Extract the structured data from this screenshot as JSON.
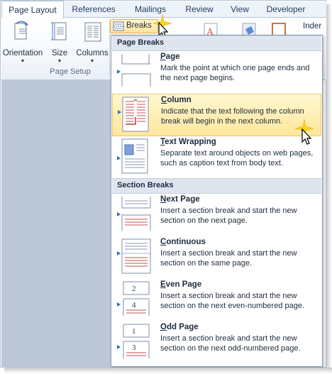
{
  "ribbon": {
    "tabs": [
      {
        "label": "Page Layout",
        "active": true
      },
      {
        "label": "References",
        "active": false
      },
      {
        "label": "Mailings",
        "active": false
      },
      {
        "label": "Review",
        "active": false
      },
      {
        "label": "View",
        "active": false
      },
      {
        "label": "Developer",
        "active": false
      }
    ],
    "buttons": {
      "orientation": "Orientation",
      "size": "Size",
      "columns": "Columns",
      "breaks": "Breaks",
      "indent": "Inder"
    },
    "group_label": "Page Setup"
  },
  "menu": {
    "page_breaks_header": "Page Breaks",
    "section_breaks_header": "Section Breaks",
    "items": [
      {
        "key": "P",
        "rest": "age",
        "desc": "Mark the point at which one page ends and the next page begins.",
        "icon": "page-break-icon",
        "highlighted": false
      },
      {
        "key": "C",
        "rest": "olumn",
        "desc": "Indicate that the text following the column break will begin in the next column.",
        "icon": "column-break-icon",
        "highlighted": true
      },
      {
        "key": "T",
        "rest": "ext Wrapping",
        "desc": "Separate text around objects on web pages, such as caption text from body text.",
        "icon": "text-wrapping-icon",
        "highlighted": false
      },
      {
        "key": "N",
        "rest": "ext Page",
        "desc": "Insert a section break and start the new section on the next page.",
        "icon": "next-page-icon",
        "highlighted": false
      },
      {
        "key": "C",
        "rest": "ontinuous",
        "desc": "Insert a section break and start the new section on the same page.",
        "icon": "continuous-icon",
        "highlighted": false
      },
      {
        "key": "E",
        "rest": "ven Page",
        "desc": "Insert a section break and start the new section on the next even-numbered page.",
        "icon": "even-page-icon",
        "highlighted": false
      },
      {
        "key": "O",
        "rest": "dd Page",
        "desc": "Insert a section break and start the new section on the next odd-numbered page.",
        "icon": "odd-page-icon",
        "highlighted": false
      }
    ],
    "even_numbers": [
      "2",
      "4"
    ],
    "odd_numbers": [
      "1",
      "3"
    ]
  },
  "colors": {
    "accent": "#ffe79d",
    "highlight_border": "#f0c75a",
    "arrow_blue": "#2a6bd1",
    "break_red": "#c0392b"
  }
}
